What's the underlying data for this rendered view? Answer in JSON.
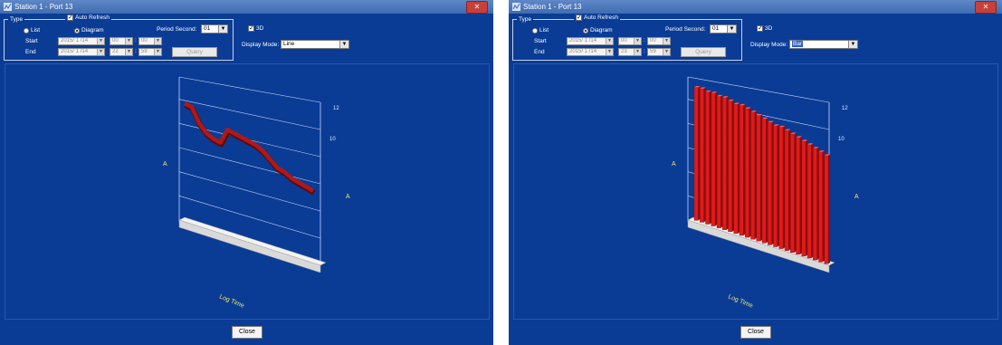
{
  "windows": [
    {
      "title": "Station 1 - Port 13",
      "type_group_label": "Type",
      "type_options": [
        {
          "label": "List",
          "selected": false
        },
        {
          "label": "Diagram",
          "selected": true
        }
      ],
      "auto_refresh": {
        "label": "Auto Refresh",
        "checked": true
      },
      "start_label": "Start",
      "end_label": "End",
      "start_date": "2015/ 1 /14",
      "start_hour": "00",
      "start_minute": "00",
      "end_date": "2015/ 1 /14",
      "end_hour": "22",
      "end_minute": "59",
      "query_label": "Query",
      "period_label": "Period Second:",
      "period_value": "01",
      "three_d": {
        "label": "3D",
        "checked": true
      },
      "display_mode_label": "Display Mode:",
      "display_mode_value": "Line",
      "close_label": "Close",
      "chart_xlabel": "Log Time",
      "chart_ylabel_left": "A",
      "chart_ylabel_right": "A"
    },
    {
      "title": "Station 1 - Port 13",
      "type_group_label": "Type",
      "type_options": [
        {
          "label": "List",
          "selected": false
        },
        {
          "label": "Diagram",
          "selected": true
        }
      ],
      "auto_refresh": {
        "label": "Auto Refresh",
        "checked": true
      },
      "start_label": "Start",
      "end_label": "End",
      "start_date": "2015/ 1 /14",
      "start_hour": "00",
      "start_minute": "00",
      "end_date": "2015/ 1 /14",
      "end_hour": "23",
      "end_minute": "59",
      "query_label": "Query",
      "period_label": "Period Second:",
      "period_value": "01",
      "three_d": {
        "label": "3D",
        "checked": true
      },
      "display_mode_label": "Display Mode:",
      "display_mode_value": "Bar",
      "close_label": "Close",
      "chart_xlabel": "Log Time",
      "chart_ylabel_left": "A",
      "chart_ylabel_right": "A"
    }
  ],
  "colors": {
    "window_bg": "#0a3c96",
    "series": "#b01818",
    "bar": "#e01a1a",
    "axis_text": "#f2e66a"
  },
  "chart_data": [
    {
      "type": "line",
      "three_d": true,
      "xlabel": "Log Time",
      "ylabel": "A",
      "y2label": "A",
      "right_ticks": [
        "12",
        "10"
      ],
      "series": [
        {
          "values": [
            11.9,
            11.85,
            11.5,
            11.3,
            11.2,
            11.15,
            11.5,
            11.45,
            11.4,
            11.35,
            11.3,
            11.2,
            11.05,
            10.9,
            10.85,
            10.75,
            10.7,
            10.65,
            10.6
          ]
        }
      ]
    },
    {
      "type": "bar",
      "three_d": true,
      "xlabel": "Log Time",
      "ylabel": "A",
      "y2label": "A",
      "right_ticks": [
        "12",
        "10"
      ],
      "series": [
        {
          "values": [
            12.3,
            12.3,
            12.25,
            12.25,
            12.2,
            12.2,
            12.15,
            12.1,
            12.1,
            12.05,
            12.0,
            11.95,
            11.9,
            11.85,
            11.8,
            11.8,
            11.75,
            11.7,
            11.65,
            11.6,
            11.55,
            11.5,
            11.45,
            11.4
          ]
        }
      ]
    }
  ]
}
